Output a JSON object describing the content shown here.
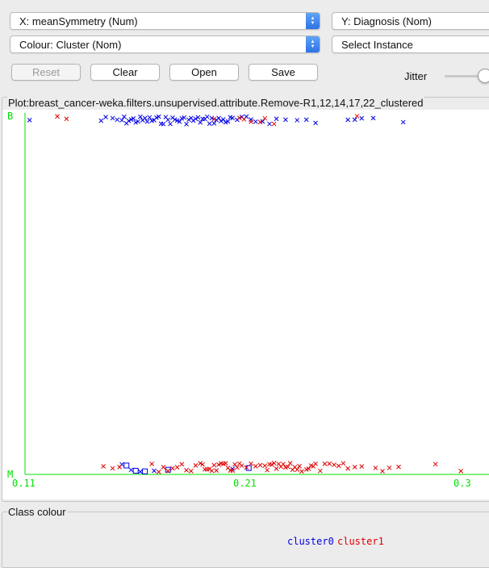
{
  "controls": {
    "x_axis": "X: meanSymmetry (Num)",
    "y_axis": "Y: Diagnosis (Nom)",
    "colour": "Colour: Cluster (Nom)",
    "select_instance": "Select Instance"
  },
  "buttons": {
    "reset": "Reset",
    "clear": "Clear",
    "open": "Open",
    "save": "Save"
  },
  "jitter": {
    "label": "Jitter",
    "value_fraction": 0.95
  },
  "plot": {
    "title": "Plot:breast_cancer-weka.filters.unsupervised.attribute.Remove-R1,12,14,17,22_clustered",
    "axis_color": "#00e000",
    "colors": {
      "cluster0": "#0000e6",
      "cluster1": "#e00000"
    }
  },
  "chart_data": {
    "type": "scatter",
    "x_ticks": [
      "0.11",
      "0.21",
      "0.3"
    ],
    "xlim": [
      0.11,
      0.3
    ],
    "y_categories": [
      "M",
      "B"
    ],
    "series": [
      {
        "name": "cluster0",
        "color": "#0000e6",
        "points": [
          {
            "x": 0.112,
            "y": "B"
          },
          {
            "x": 0.143,
            "y": "B"
          },
          {
            "x": 0.145,
            "y": "B"
          },
          {
            "x": 0.148,
            "y": "B"
          },
          {
            "x": 0.15,
            "y": "B"
          },
          {
            "x": 0.152,
            "y": "B"
          },
          {
            "x": 0.153,
            "y": "B"
          },
          {
            "x": 0.154,
            "y": "B"
          },
          {
            "x": 0.155,
            "y": "B"
          },
          {
            "x": 0.156,
            "y": "B"
          },
          {
            "x": 0.157,
            "y": "B"
          },
          {
            "x": 0.158,
            "y": "B"
          },
          {
            "x": 0.159,
            "y": "B"
          },
          {
            "x": 0.16,
            "y": "B"
          },
          {
            "x": 0.161,
            "y": "B"
          },
          {
            "x": 0.162,
            "y": "B"
          },
          {
            "x": 0.163,
            "y": "B"
          },
          {
            "x": 0.164,
            "y": "B"
          },
          {
            "x": 0.165,
            "y": "B"
          },
          {
            "x": 0.166,
            "y": "B"
          },
          {
            "x": 0.167,
            "y": "B"
          },
          {
            "x": 0.168,
            "y": "B"
          },
          {
            "x": 0.169,
            "y": "B"
          },
          {
            "x": 0.17,
            "y": "B"
          },
          {
            "x": 0.171,
            "y": "B"
          },
          {
            "x": 0.172,
            "y": "B"
          },
          {
            "x": 0.173,
            "y": "B"
          },
          {
            "x": 0.174,
            "y": "B"
          },
          {
            "x": 0.175,
            "y": "B"
          },
          {
            "x": 0.176,
            "y": "B"
          },
          {
            "x": 0.177,
            "y": "B"
          },
          {
            "x": 0.178,
            "y": "B"
          },
          {
            "x": 0.179,
            "y": "B"
          },
          {
            "x": 0.18,
            "y": "B"
          },
          {
            "x": 0.181,
            "y": "B"
          },
          {
            "x": 0.182,
            "y": "B"
          },
          {
            "x": 0.183,
            "y": "B"
          },
          {
            "x": 0.184,
            "y": "B"
          },
          {
            "x": 0.185,
            "y": "B"
          },
          {
            "x": 0.186,
            "y": "B"
          },
          {
            "x": 0.187,
            "y": "B"
          },
          {
            "x": 0.188,
            "y": "B"
          },
          {
            "x": 0.189,
            "y": "B"
          },
          {
            "x": 0.19,
            "y": "B"
          },
          {
            "x": 0.191,
            "y": "B"
          },
          {
            "x": 0.192,
            "y": "B"
          },
          {
            "x": 0.193,
            "y": "B"
          },
          {
            "x": 0.194,
            "y": "B"
          },
          {
            "x": 0.195,
            "y": "B"
          },
          {
            "x": 0.196,
            "y": "B"
          },
          {
            "x": 0.197,
            "y": "B"
          },
          {
            "x": 0.198,
            "y": "B"
          },
          {
            "x": 0.199,
            "y": "B"
          },
          {
            "x": 0.2,
            "y": "B"
          },
          {
            "x": 0.202,
            "y": "B"
          },
          {
            "x": 0.204,
            "y": "B"
          },
          {
            "x": 0.206,
            "y": "B"
          },
          {
            "x": 0.208,
            "y": "B"
          },
          {
            "x": 0.21,
            "y": "B"
          },
          {
            "x": 0.213,
            "y": "B"
          },
          {
            "x": 0.216,
            "y": "B"
          },
          {
            "x": 0.219,
            "y": "B"
          },
          {
            "x": 0.223,
            "y": "B"
          },
          {
            "x": 0.228,
            "y": "B"
          },
          {
            "x": 0.232,
            "y": "B"
          },
          {
            "x": 0.236,
            "y": "B"
          },
          {
            "x": 0.25,
            "y": "B"
          },
          {
            "x": 0.253,
            "y": "B"
          },
          {
            "x": 0.256,
            "y": "B"
          },
          {
            "x": 0.261,
            "y": "B"
          },
          {
            "x": 0.274,
            "y": "B"
          },
          {
            "x": 0.152,
            "y": "M"
          },
          {
            "x": 0.154,
            "y": "M"
          },
          {
            "x": 0.156,
            "y": "M"
          },
          {
            "x": 0.158,
            "y": "M"
          },
          {
            "x": 0.16,
            "y": "M"
          },
          {
            "x": 0.162,
            "y": "M"
          },
          {
            "x": 0.166,
            "y": "M"
          },
          {
            "x": 0.172,
            "y": "M"
          },
          {
            "x": 0.2,
            "y": "M"
          },
          {
            "x": 0.207,
            "y": "M"
          }
        ]
      },
      {
        "name": "cluster1",
        "color": "#e00000",
        "points": [
          {
            "x": 0.124,
            "y": "B"
          },
          {
            "x": 0.128,
            "y": "B"
          },
          {
            "x": 0.192,
            "y": "B"
          },
          {
            "x": 0.203,
            "y": "B"
          },
          {
            "x": 0.205,
            "y": "B"
          },
          {
            "x": 0.208,
            "y": "B"
          },
          {
            "x": 0.212,
            "y": "B"
          },
          {
            "x": 0.214,
            "y": "B"
          },
          {
            "x": 0.218,
            "y": "B"
          },
          {
            "x": 0.254,
            "y": "B"
          },
          {
            "x": 0.144,
            "y": "M"
          },
          {
            "x": 0.148,
            "y": "M"
          },
          {
            "x": 0.151,
            "y": "M"
          },
          {
            "x": 0.165,
            "y": "M"
          },
          {
            "x": 0.168,
            "y": "M"
          },
          {
            "x": 0.17,
            "y": "M"
          },
          {
            "x": 0.172,
            "y": "M"
          },
          {
            "x": 0.174,
            "y": "M"
          },
          {
            "x": 0.176,
            "y": "M"
          },
          {
            "x": 0.178,
            "y": "M"
          },
          {
            "x": 0.18,
            "y": "M"
          },
          {
            "x": 0.182,
            "y": "M"
          },
          {
            "x": 0.184,
            "y": "M"
          },
          {
            "x": 0.186,
            "y": "M"
          },
          {
            "x": 0.187,
            "y": "M"
          },
          {
            "x": 0.188,
            "y": "M"
          },
          {
            "x": 0.189,
            "y": "M"
          },
          {
            "x": 0.19,
            "y": "M"
          },
          {
            "x": 0.191,
            "y": "M"
          },
          {
            "x": 0.192,
            "y": "M"
          },
          {
            "x": 0.193,
            "y": "M"
          },
          {
            "x": 0.194,
            "y": "M"
          },
          {
            "x": 0.195,
            "y": "M"
          },
          {
            "x": 0.196,
            "y": "M"
          },
          {
            "x": 0.197,
            "y": "M"
          },
          {
            "x": 0.198,
            "y": "M"
          },
          {
            "x": 0.199,
            "y": "M"
          },
          {
            "x": 0.2,
            "y": "M"
          },
          {
            "x": 0.201,
            "y": "M"
          },
          {
            "x": 0.202,
            "y": "M"
          },
          {
            "x": 0.203,
            "y": "M"
          },
          {
            "x": 0.204,
            "y": "M"
          },
          {
            "x": 0.206,
            "y": "M"
          },
          {
            "x": 0.208,
            "y": "M"
          },
          {
            "x": 0.21,
            "y": "M"
          },
          {
            "x": 0.212,
            "y": "M"
          },
          {
            "x": 0.214,
            "y": "M"
          },
          {
            "x": 0.215,
            "y": "M"
          },
          {
            "x": 0.216,
            "y": "M"
          },
          {
            "x": 0.217,
            "y": "M"
          },
          {
            "x": 0.218,
            "y": "M"
          },
          {
            "x": 0.219,
            "y": "M"
          },
          {
            "x": 0.22,
            "y": "M"
          },
          {
            "x": 0.221,
            "y": "M"
          },
          {
            "x": 0.222,
            "y": "M"
          },
          {
            "x": 0.223,
            "y": "M"
          },
          {
            "x": 0.224,
            "y": "M"
          },
          {
            "x": 0.225,
            "y": "M"
          },
          {
            "x": 0.226,
            "y": "M"
          },
          {
            "x": 0.227,
            "y": "M"
          },
          {
            "x": 0.228,
            "y": "M"
          },
          {
            "x": 0.229,
            "y": "M"
          },
          {
            "x": 0.23,
            "y": "M"
          },
          {
            "x": 0.232,
            "y": "M"
          },
          {
            "x": 0.233,
            "y": "M"
          },
          {
            "x": 0.234,
            "y": "M"
          },
          {
            "x": 0.235,
            "y": "M"
          },
          {
            "x": 0.236,
            "y": "M"
          },
          {
            "x": 0.238,
            "y": "M"
          },
          {
            "x": 0.24,
            "y": "M"
          },
          {
            "x": 0.242,
            "y": "M"
          },
          {
            "x": 0.244,
            "y": "M"
          },
          {
            "x": 0.246,
            "y": "M"
          },
          {
            "x": 0.248,
            "y": "M"
          },
          {
            "x": 0.25,
            "y": "M"
          },
          {
            "x": 0.253,
            "y": "M"
          },
          {
            "x": 0.256,
            "y": "M"
          },
          {
            "x": 0.262,
            "y": "M"
          },
          {
            "x": 0.265,
            "y": "M"
          },
          {
            "x": 0.268,
            "y": "M"
          },
          {
            "x": 0.272,
            "y": "M"
          },
          {
            "x": 0.288,
            "y": "M"
          },
          {
            "x": 0.299,
            "y": "M"
          }
        ]
      }
    ]
  },
  "class_colour": {
    "title": "Class colour",
    "items": [
      {
        "label": "cluster0",
        "color": "#0000e6"
      },
      {
        "label": "cluster1",
        "color": "#e00000"
      }
    ]
  }
}
